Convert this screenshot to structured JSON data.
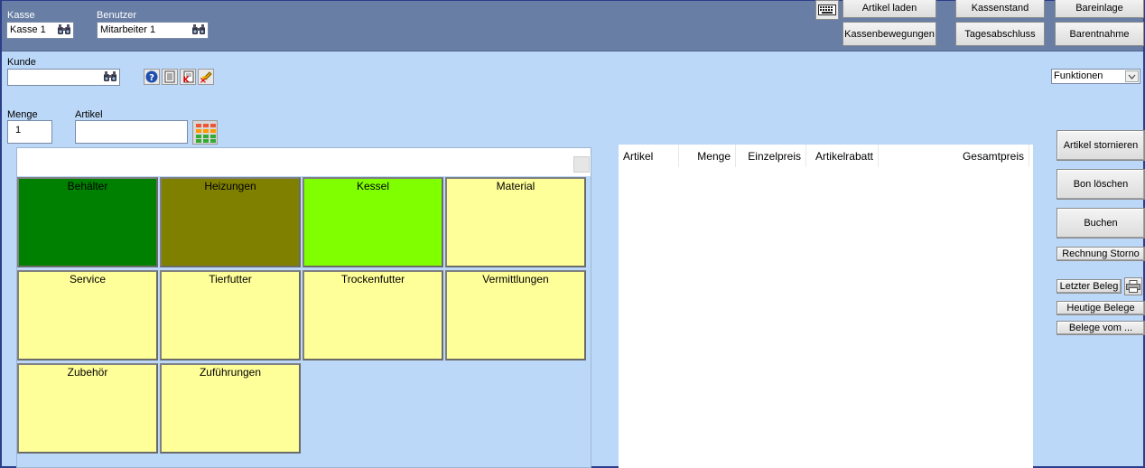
{
  "header": {
    "kasse_label": "Kasse",
    "kasse_value": "Kasse 1",
    "benutzer_label": "Benutzer",
    "benutzer_value": "Mitarbeiter 1",
    "buttons": {
      "artikel_laden": "Artikel laden",
      "kassenstand": "Kassenstand",
      "bareinlage": "Bareinlage",
      "kassenbewegungen": "Kassenbewegungen",
      "tagesabschluss": "Tagesabschluss",
      "barentnahme": "Barentnahme"
    }
  },
  "kunde": {
    "label": "Kunde",
    "value": ""
  },
  "menge": {
    "label": "Menge",
    "value": "1"
  },
  "artikel": {
    "label": "Artikel",
    "value": ""
  },
  "funktionen": {
    "selected": "Funktionen"
  },
  "categories": [
    {
      "label": "Behälter",
      "color": "#008000"
    },
    {
      "label": "Heizungen",
      "color": "#808000"
    },
    {
      "label": "Kessel",
      "color": "#80ff00"
    },
    {
      "label": "Material",
      "color": "#ffff99"
    },
    {
      "label": "Service",
      "color": "#ffff99"
    },
    {
      "label": "Tierfutter",
      "color": "#ffff99"
    },
    {
      "label": "Trockenfutter",
      "color": "#ffff99"
    },
    {
      "label": "Vermittlungen",
      "color": "#ffff99"
    },
    {
      "label": "Zubehör",
      "color": "#ffff99"
    },
    {
      "label": "Zuführungen",
      "color": "#ffff99"
    }
  ],
  "receipt_table": {
    "columns": [
      "Artikel",
      "Menge",
      "Einzelpreis",
      "Artikelrabatt",
      "Gesamtpreis"
    ]
  },
  "actions": {
    "artikel_stornieren": "Artikel stornieren",
    "bon_loeschen": "Bon löschen",
    "buchen": "Buchen",
    "rechnung_storno": "Rechnung Storno",
    "letzter_beleg": "Letzter Beleg",
    "heutige_belege": "Heutige Belege",
    "belege_vom": "Belege vom ..."
  },
  "colors": {
    "topbar": "#687ea4",
    "background": "#bcd8f8",
    "frame": "#2c3d8c"
  }
}
